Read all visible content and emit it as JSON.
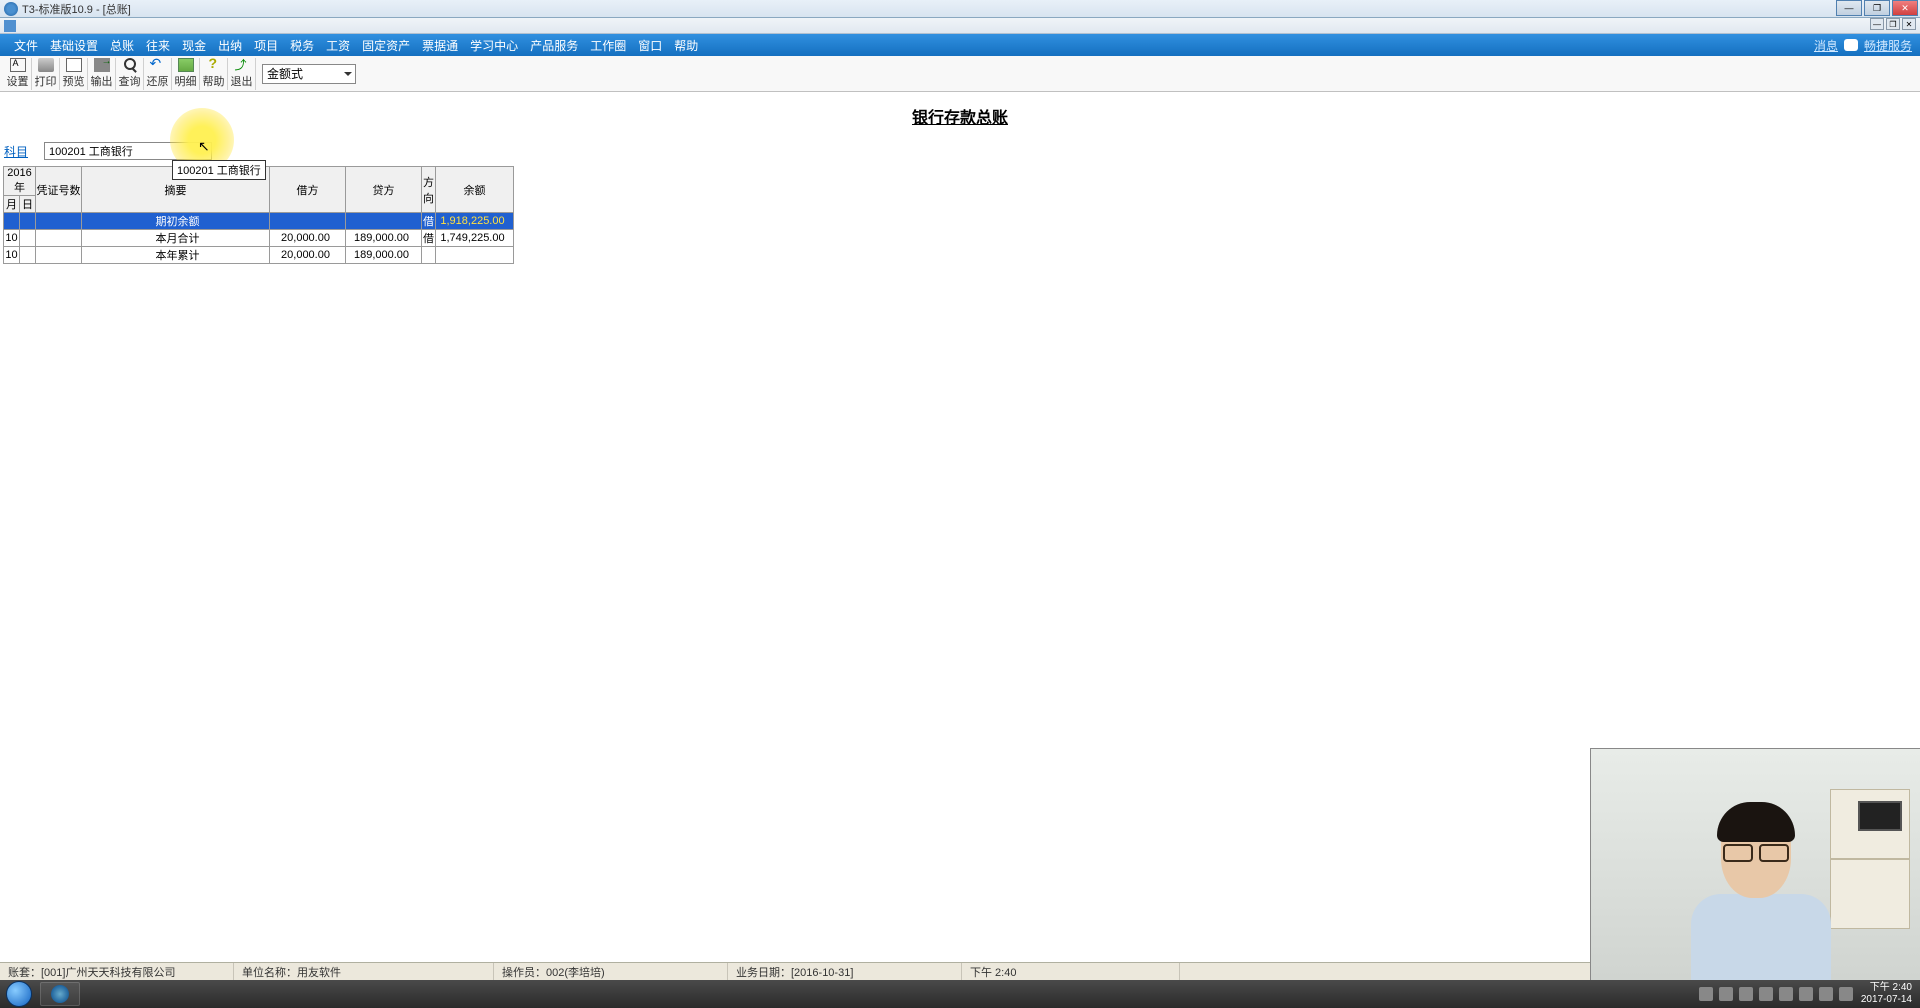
{
  "window": {
    "title": "T3-标准版10.9 - [总账]"
  },
  "menu": {
    "items": [
      "文件",
      "基础设置",
      "总账",
      "往来",
      "现金",
      "出纳",
      "项目",
      "税务",
      "工资",
      "固定资产",
      "票据通",
      "学习中心",
      "产品服务",
      "工作圈",
      "窗口",
      "帮助"
    ],
    "right": {
      "msg": "消息",
      "service": "畅捷服务"
    }
  },
  "toolbar": {
    "buttons": [
      {
        "label": "设置"
      },
      {
        "label": "打印"
      },
      {
        "label": "预览"
      },
      {
        "label": "输出"
      },
      {
        "label": "查询"
      },
      {
        "label": "还原"
      },
      {
        "label": "明细"
      },
      {
        "label": "帮助"
      },
      {
        "label": "退出"
      }
    ],
    "combo": "金额式"
  },
  "page": {
    "title": "银行存款总账"
  },
  "subject": {
    "label": "科目",
    "value": "100201 工商银行",
    "tooltip": "100201 工商银行"
  },
  "table": {
    "headers": {
      "year": "2016年",
      "month": "月",
      "day": "日",
      "voucher": "凭证号数",
      "summary": "摘要",
      "debit": "借方",
      "credit": "贷方",
      "direction": "方向",
      "balance": "余额"
    },
    "rows": [
      {
        "month": "",
        "day": "",
        "voucher": "",
        "summary": "期初余额",
        "debit": "",
        "credit": "",
        "dir": "借",
        "balance": "1,918,225.00",
        "selected": true
      },
      {
        "month": "10",
        "day": "",
        "voucher": "",
        "summary": "本月合计",
        "debit": "20,000.00",
        "credit": "189,000.00",
        "dir": "借",
        "balance": "1,749,225.00"
      },
      {
        "month": "10",
        "day": "",
        "voucher": "",
        "summary": "本年累计",
        "debit": "20,000.00",
        "credit": "189,000.00",
        "dir": "",
        "balance": ""
      }
    ]
  },
  "status": {
    "account_set": "账套：[001]广州天天科技有限公司",
    "company": "单位名称：用友软件",
    "operator": "操作员：002(李培培)",
    "biz_date": "业务日期：[2016-10-31]",
    "time": "下午 2:40"
  },
  "tray": {
    "time": "下午 2:40",
    "date": "2017-07-14"
  }
}
